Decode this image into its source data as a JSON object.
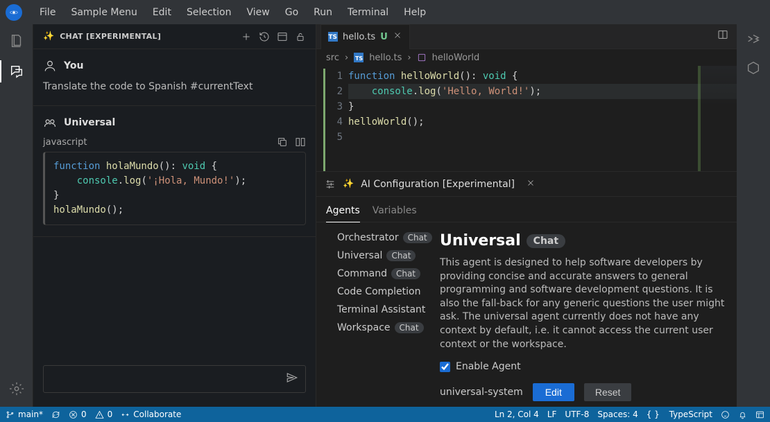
{
  "menu": [
    "File",
    "Sample Menu",
    "Edit",
    "Selection",
    "View",
    "Go",
    "Run",
    "Terminal",
    "Help"
  ],
  "chat": {
    "title": "CHAT [EXPERIMENTAL]",
    "you_label": "You",
    "you_msg": "Translate the code to Spanish #currentText",
    "agent_label": "Universal",
    "code_lang": "javascript",
    "code": {
      "l1a": "function ",
      "l1b": "holaMundo",
      "l1c": "(): ",
      "l1d": "void",
      "l1e": " {",
      "l2a": "    ",
      "l2b": "console",
      "l2c": ".",
      "l2d": "log",
      "l2e": "(",
      "l2f": "'¡Hola, Mundo!'",
      "l2g": ");",
      "l3": "}",
      "l4a": "holaMundo",
      "l4b": "();"
    }
  },
  "tab": {
    "name": "hello.ts",
    "mod": "U"
  },
  "breadcrumb": {
    "folder": "src",
    "file": "hello.ts",
    "symbol": "helloWorld"
  },
  "editor": {
    "lines": [
      "1",
      "2",
      "3",
      "4",
      "5"
    ],
    "l1a": "function ",
    "l1b": "helloWorld",
    "l1c": "(): ",
    "l1d": "void",
    "l1e": " {",
    "l2a": "    ",
    "l2b": "console",
    "l2c": ".",
    "l2d": "log",
    "l2e": "(",
    "l2f": "'Hello, World!'",
    "l2g": ");",
    "l3": "}",
    "l4a": "helloWorld",
    "l4b": "();",
    "l5": ""
  },
  "ai": {
    "title": "AI Configuration [Experimental]",
    "tabs": {
      "agents": "Agents",
      "variables": "Variables"
    },
    "agents": [
      {
        "name": "Orchestrator",
        "chip": "Chat"
      },
      {
        "name": "Universal",
        "chip": "Chat"
      },
      {
        "name": "Command",
        "chip": "Chat"
      },
      {
        "name": "Code Completion"
      },
      {
        "name": "Terminal Assistant"
      },
      {
        "name": "Workspace",
        "chip": "Chat"
      }
    ],
    "detail": {
      "name": "Universal",
      "chip": "Chat",
      "desc": "This agent is designed to help software developers by providing concise and accurate answers to general programming and software development questions. It is also the fall-back for any generic questions the user might ask. The universal agent currently does not have any context by default, i.e. it cannot access the current user context or the workspace.",
      "enable": "Enable Agent",
      "enabled": true,
      "system": "universal-system",
      "edit": "Edit",
      "reset": "Reset"
    }
  },
  "status": {
    "branch": "main*",
    "errors": "0",
    "warnings": "0",
    "collab": "Collaborate",
    "pos": "Ln 2, Col 4",
    "eol": "LF",
    "enc": "UTF-8",
    "indent": "Spaces: 4",
    "lang": "TypeScript"
  }
}
